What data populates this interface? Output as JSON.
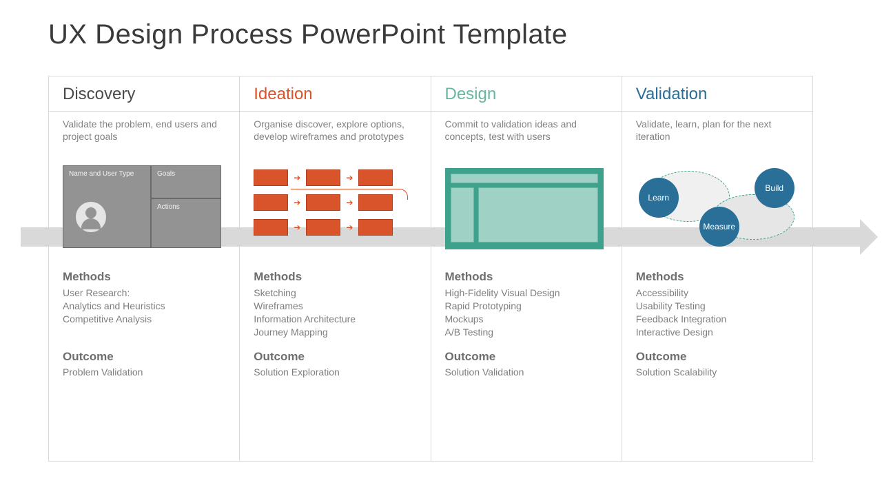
{
  "title": "UX Design Process PowerPoint Template",
  "section_labels": {
    "methods": "Methods",
    "outcome": "Outcome"
  },
  "columns": [
    {
      "heading": "Discovery",
      "desc": "Validate the problem, end users and project goals",
      "methods": "User Research:\nAnalytics and Heuristics\nCompetitive Analysis",
      "outcome": "Problem Validation",
      "persona": {
        "name_label": "Name and User Type",
        "goals_label": "Goals",
        "actions_label": "Actions"
      }
    },
    {
      "heading": "Ideation",
      "desc": "Organise discover, explore options, develop wireframes and prototypes",
      "methods": "Sketching\nWireframes\nInformation Architecture\nJourney Mapping",
      "outcome": "Solution Exploration"
    },
    {
      "heading": "Design",
      "desc": "Commit to validation ideas and concepts, test with users",
      "methods": "High-Fidelity Visual Design\nRapid Prototyping\nMockups\nA/B Testing",
      "outcome": "Solution Validation"
    },
    {
      "heading": "Validation",
      "desc": "Validate, learn, plan for the next iteration",
      "methods": "Accessibility\nUsability Testing\nFeedback Integration\nInteractive Design",
      "outcome": "Solution Scalability",
      "circles": {
        "learn": "Learn",
        "build": "Build",
        "measure": "Measure"
      }
    }
  ]
}
